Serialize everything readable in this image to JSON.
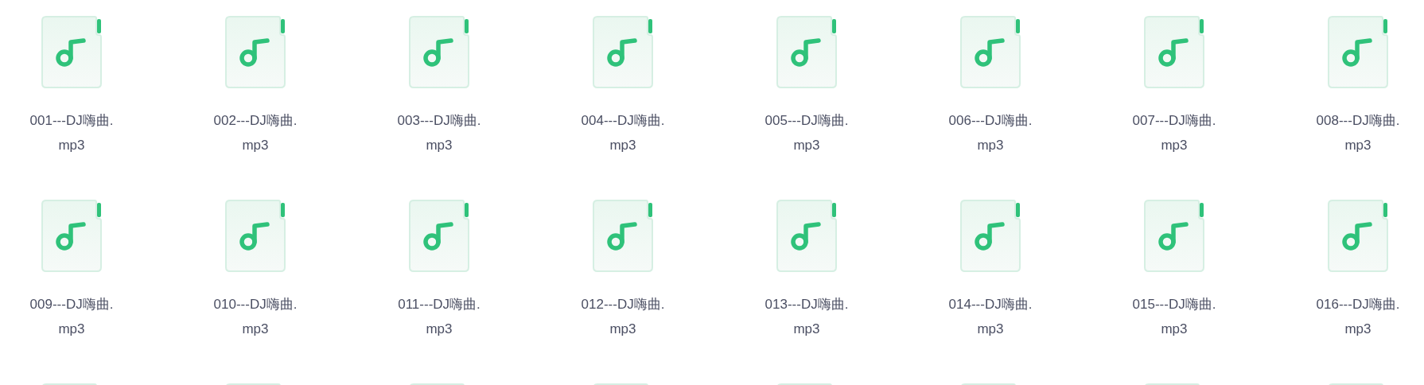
{
  "files": [
    {
      "kind": "file",
      "name_lines": [
        "001---DJ嗨曲.",
        "mp3"
      ]
    },
    {
      "kind": "file",
      "name_lines": [
        "002---DJ嗨曲.",
        "mp3"
      ]
    },
    {
      "kind": "file",
      "name_lines": [
        "003---DJ嗨曲.",
        "mp3"
      ]
    },
    {
      "kind": "file",
      "name_lines": [
        "004---DJ嗨曲.",
        "mp3"
      ]
    },
    {
      "kind": "file",
      "name_lines": [
        "005---DJ嗨曲.",
        "mp3"
      ]
    },
    {
      "kind": "file",
      "name_lines": [
        "006---DJ嗨曲.",
        "mp3"
      ]
    },
    {
      "kind": "file",
      "name_lines": [
        "007---DJ嗨曲.",
        "mp3"
      ]
    },
    {
      "kind": "file",
      "name_lines": [
        "008---DJ嗨曲.",
        "mp3"
      ]
    },
    {
      "kind": "file",
      "name_lines": [
        "009---DJ嗨曲.",
        "mp3"
      ]
    },
    {
      "kind": "file",
      "name_lines": [
        "010---DJ嗨曲.",
        "mp3"
      ]
    },
    {
      "kind": "file",
      "name_lines": [
        "011---DJ嗨曲.",
        "mp3"
      ]
    },
    {
      "kind": "file",
      "name_lines": [
        "012---DJ嗨曲.",
        "mp3"
      ]
    },
    {
      "kind": "file",
      "name_lines": [
        "013---DJ嗨曲.",
        "mp3"
      ]
    },
    {
      "kind": "file",
      "name_lines": [
        "014---DJ嗨曲.",
        "mp3"
      ]
    },
    {
      "kind": "file",
      "name_lines": [
        "015---DJ嗨曲.",
        "mp3"
      ]
    },
    {
      "kind": "file",
      "name_lines": [
        "016---DJ嗨曲.",
        "mp3"
      ]
    },
    {
      "kind": "cut_off"
    },
    {
      "kind": "cut_off"
    },
    {
      "kind": "cut_off"
    },
    {
      "kind": "cut_off"
    },
    {
      "kind": "cut_off"
    },
    {
      "kind": "cut_off"
    },
    {
      "kind": "cut_off"
    },
    {
      "kind": "cut_off"
    }
  ]
}
